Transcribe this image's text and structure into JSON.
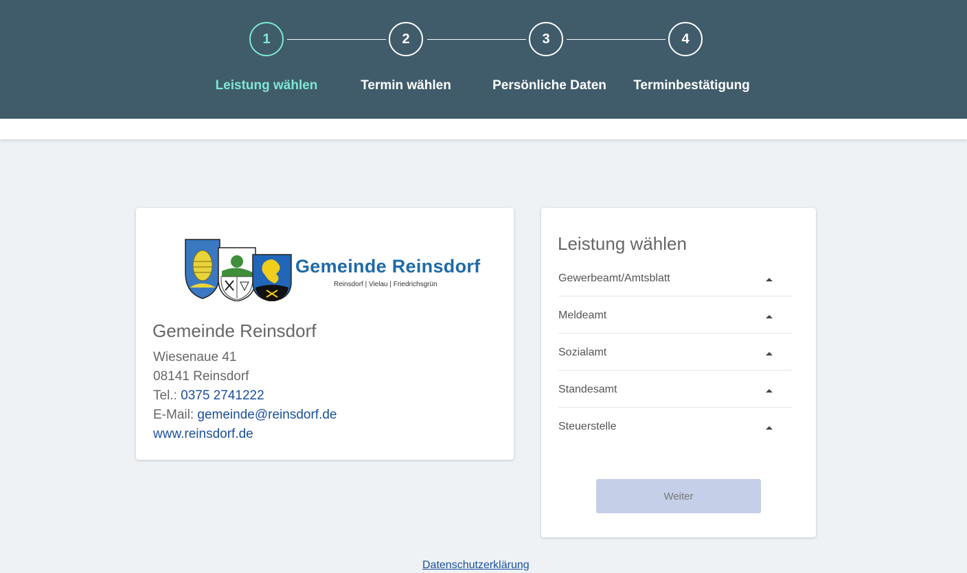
{
  "stepper": {
    "steps": [
      {
        "number": "1",
        "label": "Leistung wählen"
      },
      {
        "number": "2",
        "label": "Termin wählen"
      },
      {
        "number": "3",
        "label": "Persönliche Daten"
      },
      {
        "number": "4",
        "label": "Terminbestätigung"
      }
    ],
    "active_step": 1,
    "active_color": "#7ee8d4",
    "header_color": "#405c6b"
  },
  "org_card": {
    "logo": {
      "text": "Gemeinde Reinsdorf",
      "sub": "Reinsdorf | Vielau | Friedrichsgrün"
    },
    "name": "Gemeinde Reinsdorf",
    "street": "Wiesenaue 41",
    "city": "08141 Reinsdorf",
    "phone_label": "Tel.: ",
    "phone": "0375 2741222",
    "email_label": "E-Mail: ",
    "email": "gemeinde@reinsdorf.de",
    "website": "www.reinsdorf.de"
  },
  "service_card": {
    "title": "Leistung wählen",
    "services": [
      {
        "label": "Gewerbeamt/Amtsblatt"
      },
      {
        "label": "Meldeamt"
      },
      {
        "label": "Sozialamt"
      },
      {
        "label": "Standesamt"
      },
      {
        "label": "Steuerstelle"
      }
    ],
    "next_button": "Weiter"
  },
  "footer": {
    "privacy_link": "Datenschutzerklärung"
  }
}
